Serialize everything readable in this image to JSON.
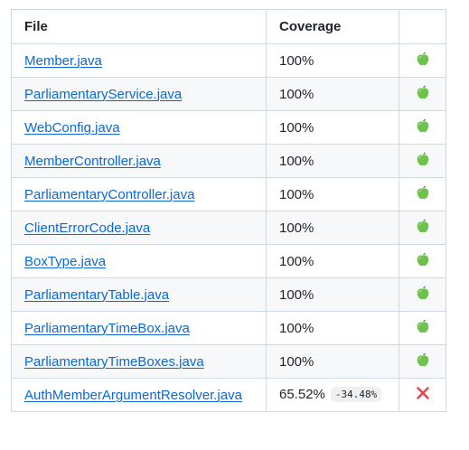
{
  "table": {
    "headers": {
      "file": "File",
      "coverage": "Coverage",
      "status": ""
    },
    "rows": [
      {
        "file": "Member.java",
        "coverage": "100%",
        "delta": "",
        "status": "pass-apple-icon"
      },
      {
        "file": "ParliamentaryService.java",
        "coverage": "100%",
        "delta": "",
        "status": "pass-apple-icon"
      },
      {
        "file": "WebConfig.java",
        "coverage": "100%",
        "delta": "",
        "status": "pass-apple-icon"
      },
      {
        "file": "MemberController.java",
        "coverage": "100%",
        "delta": "",
        "status": "pass-apple-icon"
      },
      {
        "file": "ParliamentaryController.java",
        "coverage": "100%",
        "delta": "",
        "status": "pass-apple-icon"
      },
      {
        "file": "ClientErrorCode.java",
        "coverage": "100%",
        "delta": "",
        "status": "pass-apple-icon"
      },
      {
        "file": "BoxType.java",
        "coverage": "100%",
        "delta": "",
        "status": "pass-apple-icon"
      },
      {
        "file": "ParliamentaryTable.java",
        "coverage": "100%",
        "delta": "",
        "status": "pass-apple-icon"
      },
      {
        "file": "ParliamentaryTimeBox.java",
        "coverage": "100%",
        "delta": "",
        "status": "pass-apple-icon"
      },
      {
        "file": "ParliamentaryTimeBoxes.java",
        "coverage": "100%",
        "delta": "",
        "status": "pass-apple-icon"
      },
      {
        "file": "AuthMemberArgumentResolver.java",
        "coverage": "65.52%",
        "delta": "-34.48%",
        "status": "fail-cross-icon"
      }
    ]
  },
  "colors": {
    "link": "#0969da",
    "pass_icon": "#6cc24a",
    "fail_icon": "#e5484d",
    "border": "#d1d9e0",
    "stripe": "#f6f8fa"
  }
}
